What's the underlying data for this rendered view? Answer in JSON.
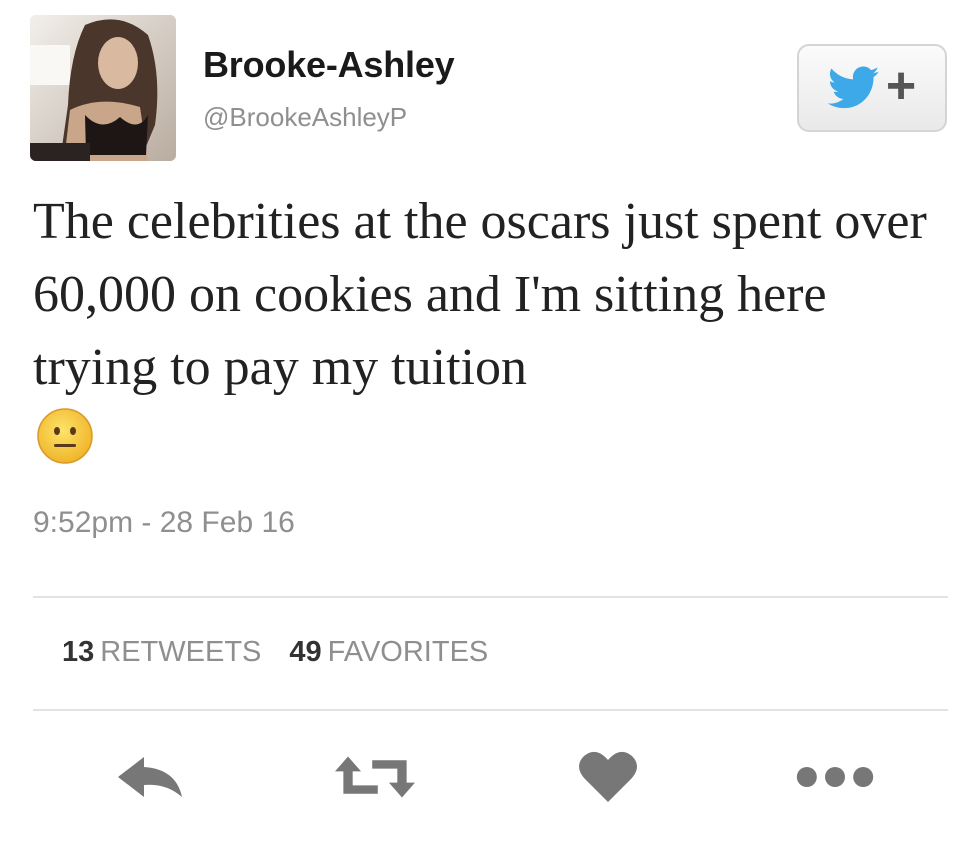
{
  "user": {
    "display_name": "Brooke-Ashley",
    "handle": "@BrookeAshleyP"
  },
  "follow_button": {
    "icon": "twitter-bird-icon",
    "plus_label": "+"
  },
  "tweet": {
    "text": "The celebrities at the oscars just spent over 60,000 on cookies and I'm sitting here trying to pay my tuition",
    "emoji": "neutral-face-emoji",
    "timestamp": "9:52pm - 28 Feb 16"
  },
  "stats": {
    "retweets_count": "13",
    "retweets_label": "RETWEETS",
    "favorites_count": "49",
    "favorites_label": "FAVORITES"
  },
  "actions": [
    "reply-icon",
    "retweet-icon",
    "heart-icon",
    "more-icon"
  ],
  "colors": {
    "twitter_blue": "#3ea9e8",
    "icon_gray": "#777777",
    "meta_gray": "#8f8f8f"
  }
}
